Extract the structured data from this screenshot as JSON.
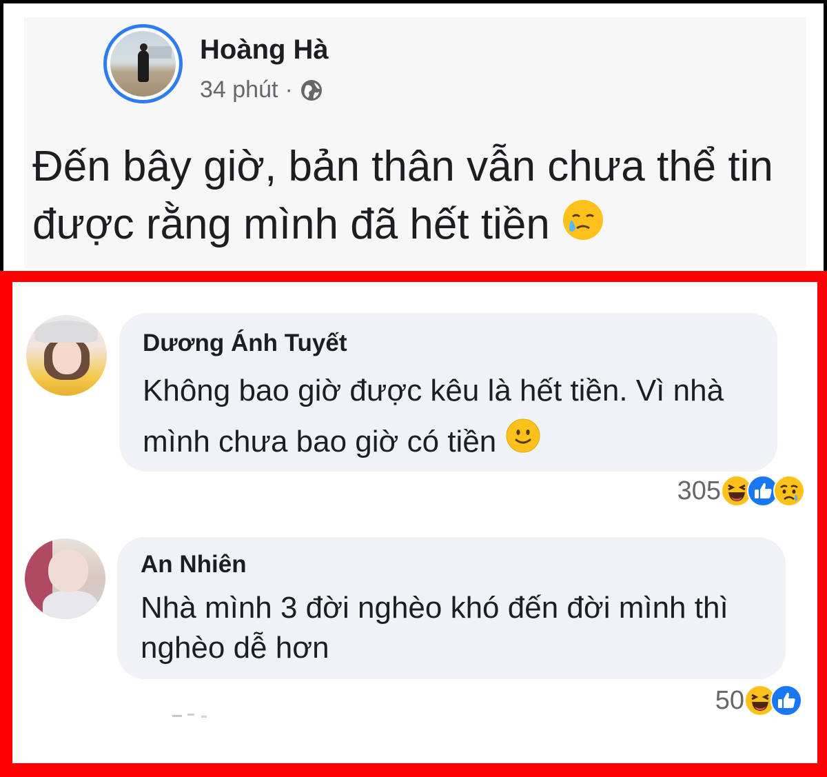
{
  "post": {
    "author": "Hoàng Hà",
    "time": "34 phút",
    "separator": "·",
    "privacy_icon": "globe-icon",
    "text": "Đến bây giờ, bản thân vẫn chưa thể tin được rằng mình đã hết tiền",
    "emoji": "crying-smile-emoji"
  },
  "comments": [
    {
      "author": "Dương Ánh Tuyết",
      "text": "Không bao giờ được kêu là hết tiền. Vì nhà mình chưa bao giờ có tiền",
      "emoji": "slight-smile-emoji",
      "reaction_count": "305",
      "reactions": [
        "haha",
        "like",
        "sad"
      ]
    },
    {
      "author": "An Nhiên",
      "text": "Nhà mình 3 đời nghèo khó đến đời mình thì nghèo dễ hơn",
      "reaction_count": "50",
      "reactions": [
        "haha",
        "like"
      ]
    }
  ],
  "colors": {
    "frame": "#ff0000",
    "bubble": "#f0f2f5",
    "avatar_ring": "#2d7df0",
    "like_blue": "#1877f2",
    "emoji_yellow": "#fcc21b"
  }
}
